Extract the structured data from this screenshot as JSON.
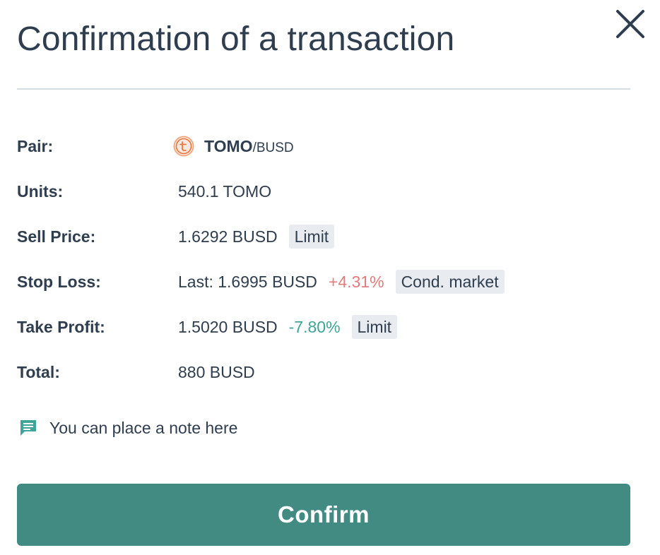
{
  "modal": {
    "title": "Confirmation of a transaction",
    "close_icon": "close-icon"
  },
  "details": {
    "pair": {
      "label": "Pair:",
      "icon": "tomo-coin-icon",
      "base": "TOMO",
      "quote": "/BUSD"
    },
    "units": {
      "label": "Units:",
      "value": "540.1 TOMO"
    },
    "sell_price": {
      "label": "Sell Price:",
      "value": "1.6292 BUSD",
      "tag": "Limit"
    },
    "stop_loss": {
      "label": "Stop Loss:",
      "value": "Last: 1.6995 BUSD",
      "change": "+4.31%",
      "change_color": "#e07c7c",
      "tag": "Cond. market"
    },
    "take_profit": {
      "label": "Take Profit:",
      "value": "1.5020 BUSD",
      "change": "-7.80%",
      "change_color": "#3ea597",
      "tag": "Limit"
    },
    "total": {
      "label": "Total:",
      "value": "880 BUSD"
    }
  },
  "note": {
    "icon": "comment-icon",
    "text": "You can place a note here"
  },
  "confirm": {
    "label": "Confirm",
    "color": "#428b83"
  }
}
